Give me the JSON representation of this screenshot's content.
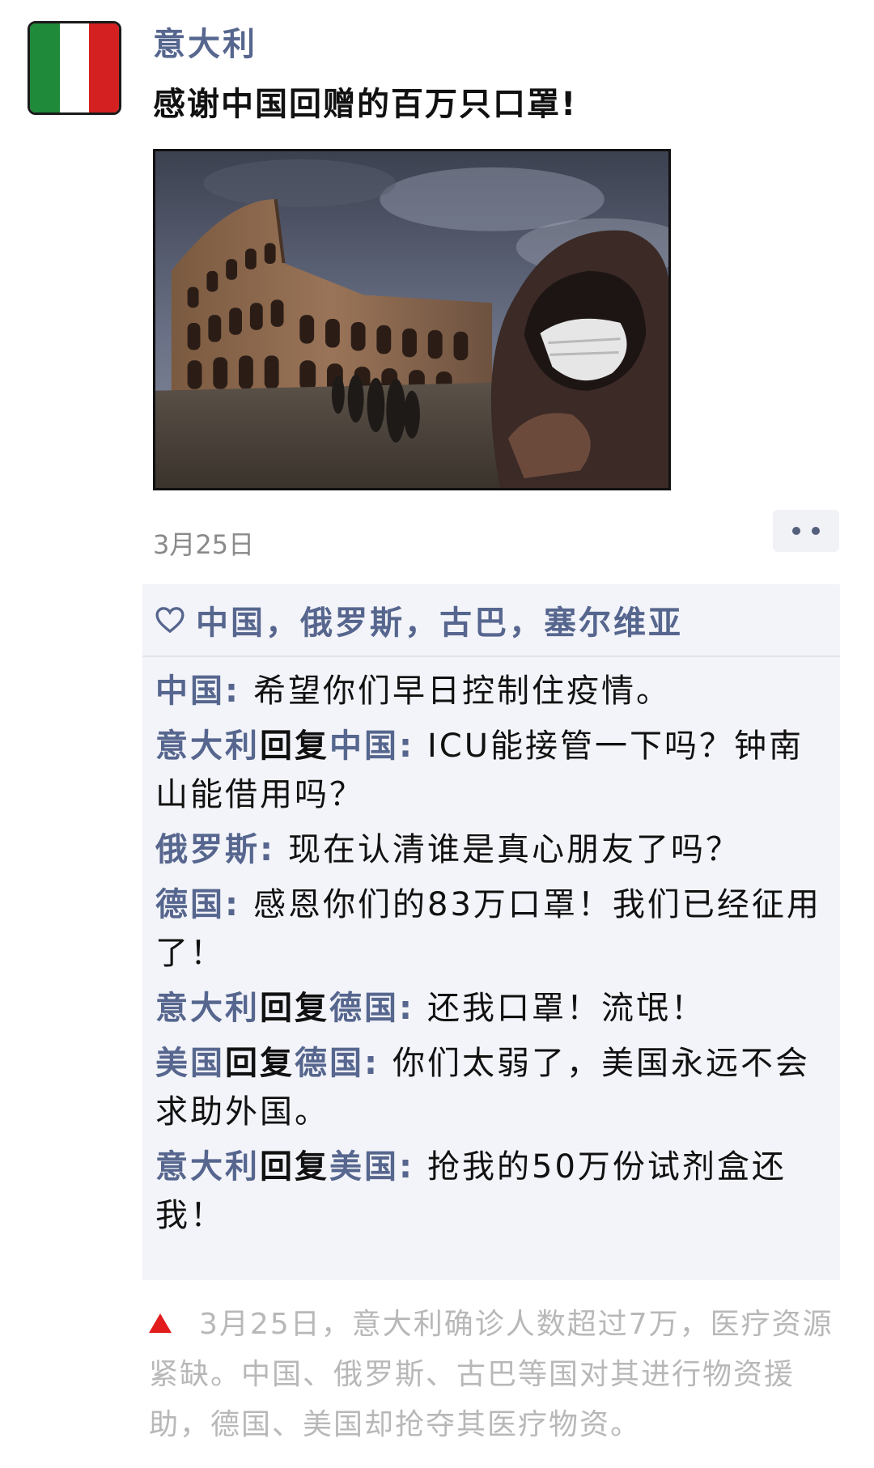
{
  "post": {
    "author": "意大利",
    "text": "感谢中国回赠的百万只口罩!",
    "date": "3月25日",
    "avatar_flag_colors": [
      "#1f8a3a",
      "#ffffff",
      "#d42020"
    ],
    "image_icon": "colosseum-photo"
  },
  "likes": {
    "icon": "heart-icon",
    "names": "中国，俄罗斯，古巴，塞尔维亚"
  },
  "comments": [
    {
      "author": "中国",
      "reply_word": "",
      "reply_to": "",
      "colon": ":",
      "text": "希望你们早日控制住疫情。"
    },
    {
      "author": "意大利",
      "reply_word": "回复",
      "reply_to": "中国",
      "colon": ":",
      "text": "ICU能接管一下吗？钟南山能借用吗？"
    },
    {
      "author": "俄罗斯",
      "reply_word": "",
      "reply_to": "",
      "colon": ":",
      "text": "现在认清谁是真心朋友了吗？"
    },
    {
      "author": "德国",
      "reply_word": "",
      "reply_to": "",
      "colon": ":",
      "text": "感恩你们的83万口罩！我们已经征用了！"
    },
    {
      "author": "意大利",
      "reply_word": "回复",
      "reply_to": "德国",
      "colon": ":",
      "text": "还我口罩！流氓！"
    },
    {
      "author": "美国",
      "reply_word": "回复",
      "reply_to": "德国",
      "colon": ":",
      "text": "你们太弱了，美国永远不会求助外国。"
    },
    {
      "author": "意大利",
      "reply_word": "回复",
      "reply_to": "美国",
      "colon": ":",
      "text": "抢我的50万份试剂盒还我！"
    }
  ],
  "footnote": {
    "icon": "triangle-marker-icon",
    "text": "3月25日，意大利确诊人数超过7万，医疗资源紧缺。中国、俄罗斯、古巴等国对其进行物资援助，德国、美国却抢夺其医疗物资。"
  },
  "colors": {
    "name_blue": "#56668e",
    "comment_bg": "#f3f4f9",
    "note_gray": "#b8b8b8",
    "marker_red": "#e21c1c"
  }
}
